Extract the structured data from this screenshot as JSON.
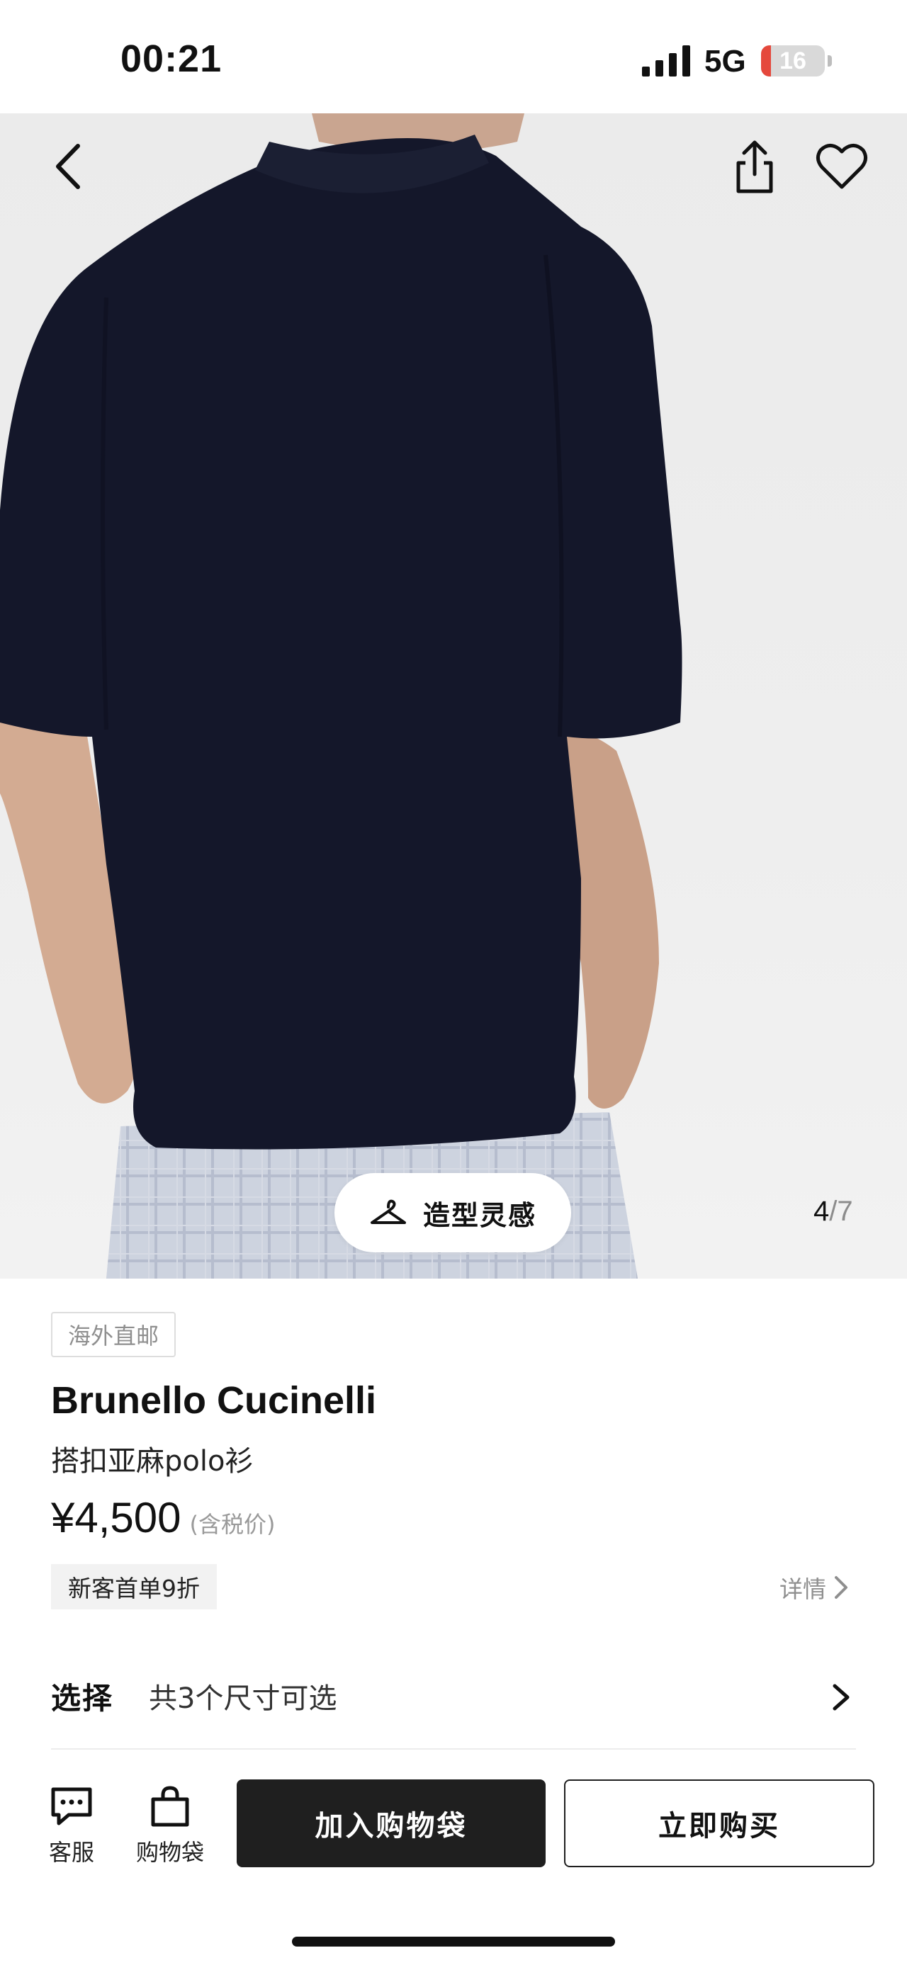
{
  "status_bar": {
    "time": "00:21",
    "network": "5G",
    "battery_level": "16",
    "battery_fraction": 0.16,
    "signal_icon": "signal-bars-icon"
  },
  "hero": {
    "top_actions": {
      "back_icon": "chevron-left-icon",
      "share_icon": "share-icon",
      "favorite_icon": "heart-outline-icon"
    },
    "style_pill": {
      "icon": "hanger-icon",
      "label": "造型灵感"
    },
    "counter": {
      "current": "4",
      "separator": "/",
      "total": "7"
    }
  },
  "product": {
    "tag": "海外直邮",
    "brand": "Brunello Cucinelli",
    "name": "搭扣亚麻polo衫",
    "price": "¥4,500",
    "tax_note": "(含税价)",
    "promo": "新客首单9折",
    "details_label": "详情"
  },
  "selection": {
    "label": "选择",
    "value": "共3个尺寸可选"
  },
  "bottom_bar": {
    "customer_service_label": "客服",
    "bag_label": "购物袋",
    "add_to_bag": "加入购物袋",
    "buy_now": "立即购买",
    "customer_service_icon": "chat-bubble-icon",
    "bag_icon": "shopping-bag-icon"
  },
  "colors": {
    "shirt": "#14172a",
    "primary_button": "#1f1f1f",
    "battery_alert": "#e5483c",
    "muted_text": "#8f8f8f"
  }
}
